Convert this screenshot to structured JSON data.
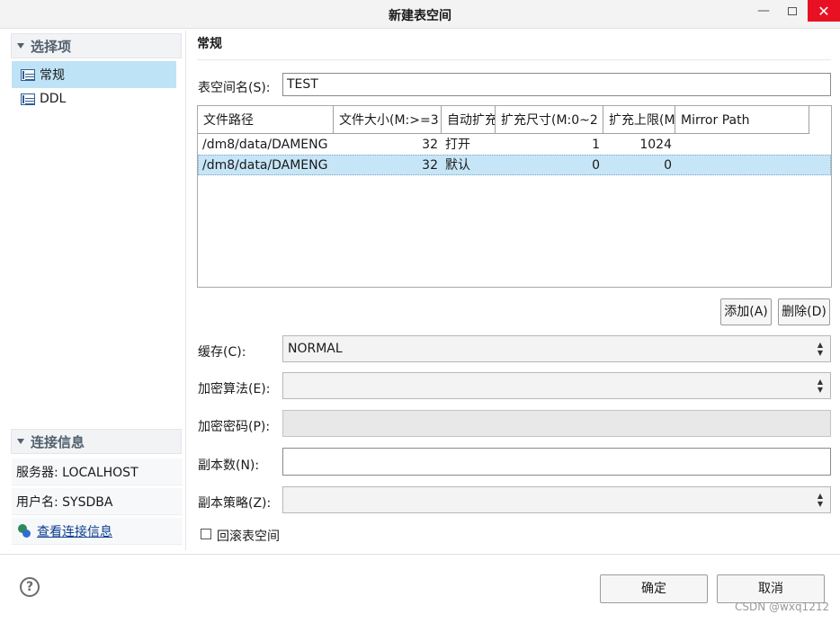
{
  "window": {
    "title": "新建表空间"
  },
  "sidebar": {
    "options_header": "选择项",
    "items": [
      {
        "label": "常规",
        "selected": true
      },
      {
        "label": "DDL",
        "selected": false
      }
    ],
    "connection_header": "连接信息",
    "server": "服务器: LOCALHOST",
    "user": "用户名: SYSDBA",
    "view_link": "查看连接信息"
  },
  "main": {
    "page_title": "常规",
    "tablespace_name_label": "表空间名(S):",
    "tablespace_name_value": "TEST",
    "table": {
      "columns": [
        "文件路径",
        "文件大小(M:>=3",
        "自动扩充",
        "扩充尺寸(M:0~2",
        "扩充上限(M",
        "Mirror Path"
      ],
      "rows": [
        [
          "/dm8/data/DAMENG",
          "32",
          "打开",
          "1",
          "1024",
          ""
        ],
        [
          "/dm8/data/DAMENG",
          "32",
          "默认",
          "0",
          "0",
          ""
        ]
      ],
      "selected_row": 1
    },
    "add_button": "添加(A)",
    "delete_button": "删除(D)",
    "cache_label": "缓存(C):",
    "cache_value": "NORMAL",
    "encrypt_algo_label": "加密算法(E):",
    "encrypt_algo_value": "",
    "encrypt_password_label": "加密密码(P):",
    "replica_count_label": "副本数(N):",
    "replica_count_value": "",
    "replica_policy_label": "副本策略(Z):",
    "replica_policy_value": "",
    "rollback_label": "回滚表空间"
  },
  "footer": {
    "ok": "确定",
    "cancel": "取消",
    "watermark": "CSDN @wxq1212"
  }
}
